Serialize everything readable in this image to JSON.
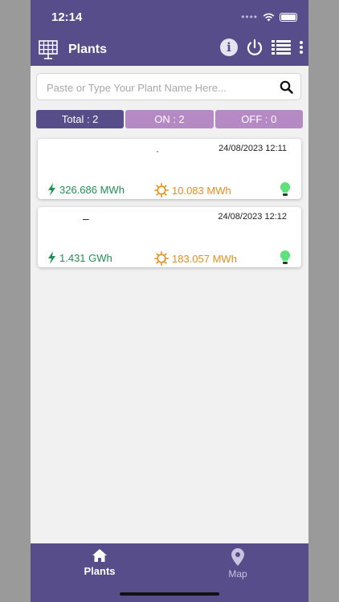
{
  "status_bar": {
    "time": "12:14"
  },
  "header": {
    "title": "Plants"
  },
  "search": {
    "placeholder": "Paste or Type Your Plant Name Here..."
  },
  "filters": {
    "total": "Total : 2",
    "on": "ON : 2",
    "off": "OFF : 0"
  },
  "plants": [
    {
      "name": "·",
      "date": "24/08/2023 12:11",
      "energy": "326.686 MWh",
      "power": "10.083 MWh"
    },
    {
      "name": "–",
      "date": "24/08/2023 12:12",
      "energy": "1.431 GWh",
      "power": "183.057 MWh"
    }
  ],
  "tabbar": {
    "plants_label": "Plants",
    "map_label": "Map"
  },
  "colors": {
    "primary": "#574d8a",
    "filter_inactive": "#b589c3",
    "energy": "#1f9152",
    "power": "#e88d1c",
    "bulb": "#5ee07a"
  },
  "icons": [
    "solar-panel-icon",
    "info-icon",
    "power-icon",
    "list-icon",
    "more-vertical-icon",
    "search-icon",
    "lightning-icon",
    "sun-icon",
    "bulb-icon",
    "home-icon",
    "map-pin-icon"
  ]
}
